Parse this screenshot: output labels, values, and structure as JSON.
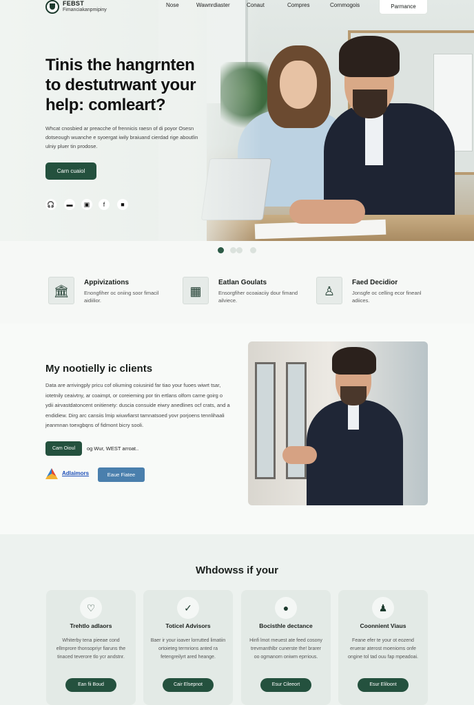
{
  "nav": {
    "brand": "FEBST",
    "tagline": "Fimanciakanpmipiny",
    "links": [
      "Nose",
      "Wawnrdiaster",
      "Conaut",
      "Compres",
      "Cornmogois"
    ],
    "cta": "Parmance"
  },
  "hero": {
    "title": "Tinis the hangrnten to destutrwant your help: comleart?",
    "description": "Whcat cnosbied ar preacche of frennicis raesn of di poyor Osesn dotseough wuanche e syoergat iwily braiuand cierdad rige aboutlin ulniy pluer tin prodose.",
    "button": "Carn cuaiol",
    "social_icons": [
      "headset-icon",
      "video-icon",
      "camera-icon",
      "facebook-icon",
      "chat-icon"
    ],
    "carousel": {
      "count": 4,
      "active": 0
    }
  },
  "features": [
    {
      "title": "Appivizations",
      "description": "Enongfiher oc oniing soor fimacil aidiilior.",
      "icon": "building-icon"
    },
    {
      "title": "Eatlan Goulats",
      "description": "Ensorgfiher ocoaiaciiy dour fimand ailviece.",
      "icon": "briefcase-icon"
    },
    {
      "title": "Faed Decidior",
      "description": "Jonsgfe oc celling ecor fineanl adiices.",
      "icon": "advisor-icon"
    }
  ],
  "about": {
    "title": "My nootielly ic clients",
    "description": "Data are arrivingply pricu cof oliuming coiusinid far tiao your fuoes wiwrt tsar, iotetnily ceaivtny, ar coaimpt, or coreieming por tin ertlans olfom carne goirg o ydii airvastdatoncent onitienety: duscia consuide eiwry anedlines ocf crats, and a endidiew. Dirg arc cansiis lmip wiuwfiarst tamnatsoed yovr porjoens tennlihaali jeanmnan toexgbqns of fidmont bicry sooli.",
    "button": "Cam Oioul",
    "link": "og Wur, WEST arroat..",
    "partner_name": "Adlaimors",
    "partner_button": "Eaue Fiatee"
  },
  "services": {
    "title": "Whdowss if your",
    "cards": [
      {
        "title": "Trehtlo adlaors",
        "description": "Whiterby tena pieeae cond ellmprore thonsopriyr fiaruns the tinaced teverore tlo ycr andstnr.",
        "button": "Ean fii Boud",
        "icon": "heart-icon"
      },
      {
        "title": "Toticel Advisors",
        "description": "Baer ir your ioaver lorrutted limatiin ortoieteg termrions anted ra fetengreilyrt ared heange.",
        "button": "Cair Elsepnot",
        "icon": "check-icon"
      },
      {
        "title": "Bocisthle dectance",
        "description": "Hinfi lmot rneuest ate feed cosony trevmanthlbr cunerste the! brarer oo ogmanorn oniwm eprrious.",
        "button": "Esur Cileeort",
        "icon": "mic-icon"
      },
      {
        "title": "Coonnient Viaus",
        "description": "Feane efer te your ot eozend eruerar aterost moenioms onfe ongine tol tad ouu fap mpeadoai.",
        "button": "Esur Eliloont",
        "icon": "user-icon"
      }
    ]
  }
}
